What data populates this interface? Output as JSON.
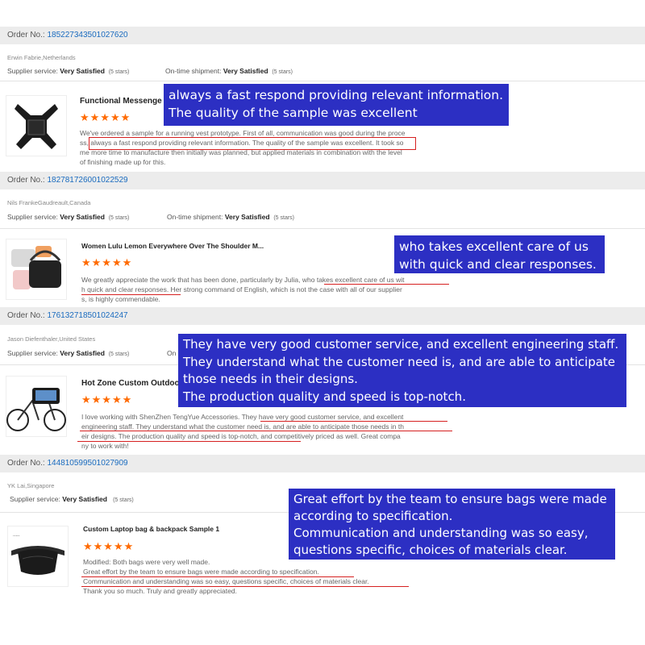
{
  "reviews": [
    {
      "order_label": "Order No.:",
      "order_no": "185227343501027620",
      "reviewer": "Erwin Fabrie,Netherlands",
      "supplier_label": "Supplier service:",
      "supplier_value": "Very Satisfied",
      "supplier_stars": "(5 stars)",
      "shipment_label": "On-time shipment:",
      "shipment_value": "Very Satisfied",
      "shipment_stars": "(5 stars)",
      "product": "Functional Messenge",
      "stars": "★★★★★",
      "text_lines": [
        "We've ordered a sample for a running vest prototype. First of all, communication was good during the proce",
        "ss, always a fast respond providing relevant information. The quality of the sample was excellent. It took so",
        "me more time to manufacture then initially was planned, but applied materials in combination with the level",
        "of finishing made up for this."
      ],
      "callout": [
        "always a fast respond providing relevant information.",
        "The quality of the sample was excellent"
      ]
    },
    {
      "order_label": "Order No.:",
      "order_no": "182781726001022529",
      "reviewer": "Nils FrankeGaudreault,Canada",
      "supplier_label": "Supplier service:",
      "supplier_value": "Very Satisfied",
      "supplier_stars": "(5 stars)",
      "shipment_label": "On-time shipment:",
      "shipment_value": "Very Satisfied",
      "shipment_stars": "(5 stars)",
      "product": "Women Lulu Lemon Everywhere Over The Shoulder M...",
      "stars": "★★★★★",
      "text_lines": [
        "We greatly appreciate the work that has been done, particularly by Julia, who takes excellent care of us wit",
        "h quick and clear responses. Her strong command of English, which is not the case with all of our supplier",
        "s, is highly commendable."
      ],
      "callout": [
        "who takes excellent care of us",
        "with quick and clear responses."
      ]
    },
    {
      "order_label": "Order No.:",
      "order_no": "176132718501024247",
      "reviewer": "Jason Diefenthaler,United States",
      "supplier_label": "Supplier service:",
      "supplier_value": "Very Satisfied",
      "supplier_stars": "(5 stars)",
      "shipment_label": "On",
      "product": "Hot Zone Custom Outdoo",
      "stars": "★★★★★",
      "text_lines": [
        "I love working with ShenZhen TengYue Accessories.  They have very good customer service, and excellent",
        "engineering staff.  They understand what the customer need is, and are able to anticipate those needs in th",
        "eir designs.  The production quality and speed is top-notch, and competitively priced as well.  Great compa",
        "ny to work with!"
      ],
      "callout": [
        "They have very good customer service, and excellent engineering staff.",
        "They understand what the customer need is, and are able to anticipate",
        "those needs in their designs.",
        "The production quality and speed is top-notch."
      ]
    },
    {
      "order_label": "Order No.:",
      "order_no": "144810599501027909",
      "reviewer": "YK Lai,Singapore",
      "supplier_label": "Supplier service:",
      "supplier_value": "Very Satisfied",
      "supplier_stars": "(5 stars)",
      "product": "Custom Laptop bag & backpack Sample 1",
      "stars": "★★★★★",
      "text_lines": [
        "Modified: Both bags were very well made.",
        "Great effort by the team to ensure bags were made according to specification.",
        "Communication and understanding was so easy, questions specific, choices of materials clear.",
        "Thank you so much. Truly and greatly appreciated."
      ],
      "modified_label": "Modified:",
      "callout": [
        "Great effort by the team to ensure bags were made",
        "according to specification.",
        "Communication and understanding was so easy,",
        "questions specific, choices of materials clear."
      ]
    }
  ],
  "colors": {
    "accent_order": "#1a6bbf",
    "stars": "#ff6a00",
    "callout_bg": "#2c2fc3",
    "underline": "#d62020"
  },
  "thumb_icons": [
    "vest-harness-icon",
    "shoulder-bag-icon",
    "bike-frame-bag-icon",
    "waist-pack-icon"
  ]
}
